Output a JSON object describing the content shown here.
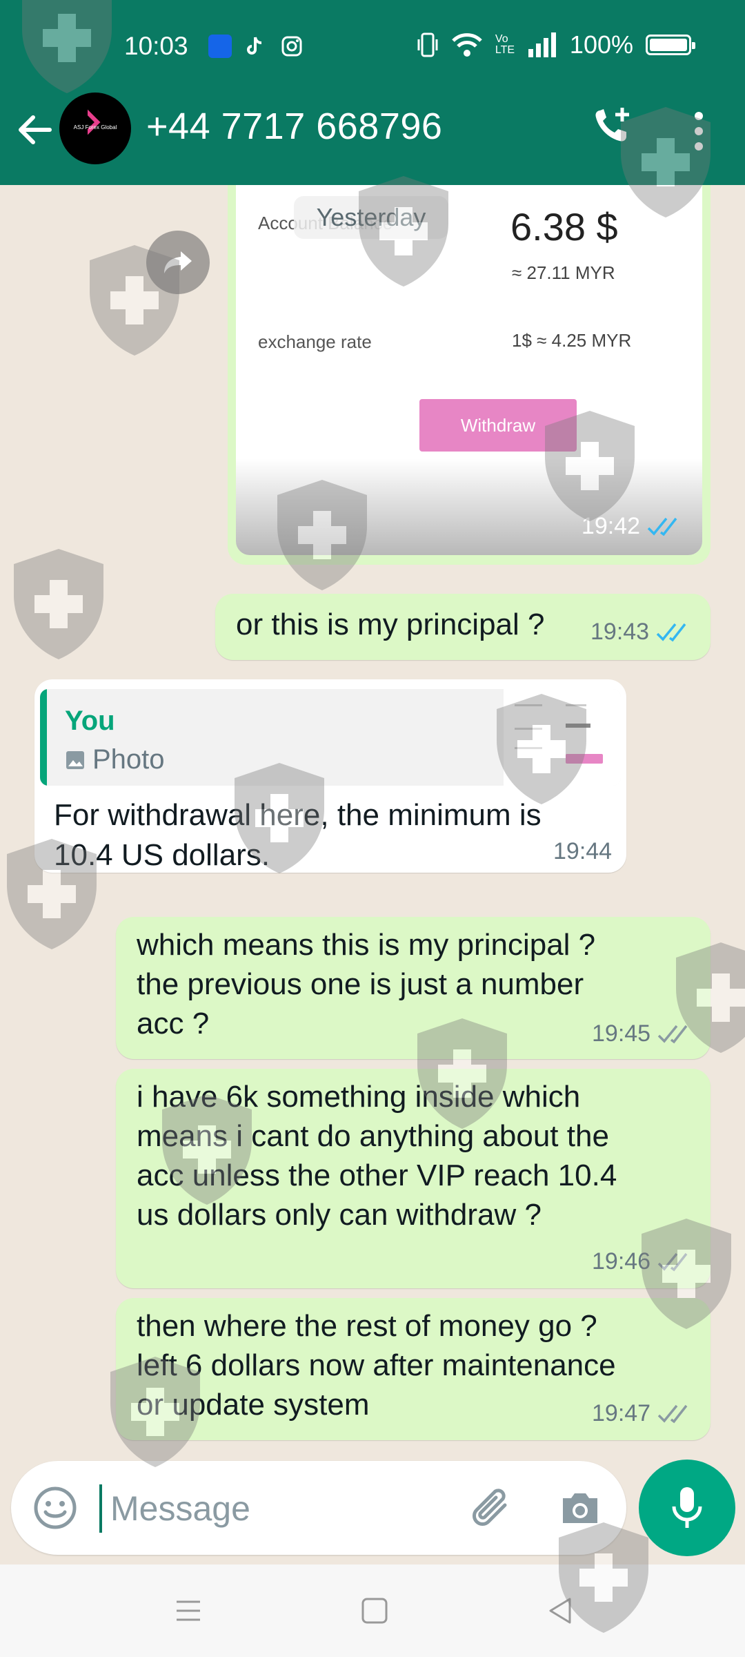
{
  "status_bar": {
    "time": "10:03",
    "battery": "100%",
    "network": "Vo LTE"
  },
  "header": {
    "contact": "+44 7717 668796",
    "avatar_text": "ASJ Forex Global"
  },
  "messages": {
    "image_msg": {
      "date_chip": "Yesterday",
      "label_balance": "Account Balance",
      "balance": "6.38 $",
      "balance_myr": "≈ 27.11 MYR",
      "label_rate": "exchange rate",
      "rate": "1$ ≈ 4.25 MYR",
      "button": "Withdraw",
      "time": "19:42"
    },
    "m1": {
      "text": "or this is my principal ?",
      "time": "19:43"
    },
    "m2": {
      "quote_author": "You",
      "quote_type": "Photo",
      "text_line1": "For withdrawal here, the minimum is",
      "text_line2": "10.4 US dollars.",
      "time": "19:44"
    },
    "m3": {
      "line1": "which means this is my principal ?",
      "line2": "the previous one is just a number",
      "line3": "acc ?",
      "time": "19:45"
    },
    "m4": {
      "line1": "i have 6k something inside which",
      "line2": "means i cant do anything about the",
      "line3": "acc unless the other VIP reach 10.4",
      "line4": "us dollars only can withdraw ?",
      "time": "19:46"
    },
    "m5": {
      "line1": "then where the rest of money go ?",
      "line2": "left 6 dollars now after maintenance",
      "line3": "or update system",
      "time": "19:47"
    }
  },
  "input": {
    "placeholder": "Message"
  },
  "colors": {
    "header": "#0a7a63",
    "outgoing_bubble": "#dcf8c6",
    "incoming_bubble": "#ffffff",
    "read_ticks": "#34b7f1",
    "mic_button": "#00a884"
  },
  "icons": [
    "back-arrow-icon",
    "add-call-icon",
    "more-vert-icon",
    "forward-icon",
    "photo-icon",
    "emoji-icon",
    "attach-icon",
    "camera-icon",
    "mic-icon",
    "double-tick-icon"
  ]
}
